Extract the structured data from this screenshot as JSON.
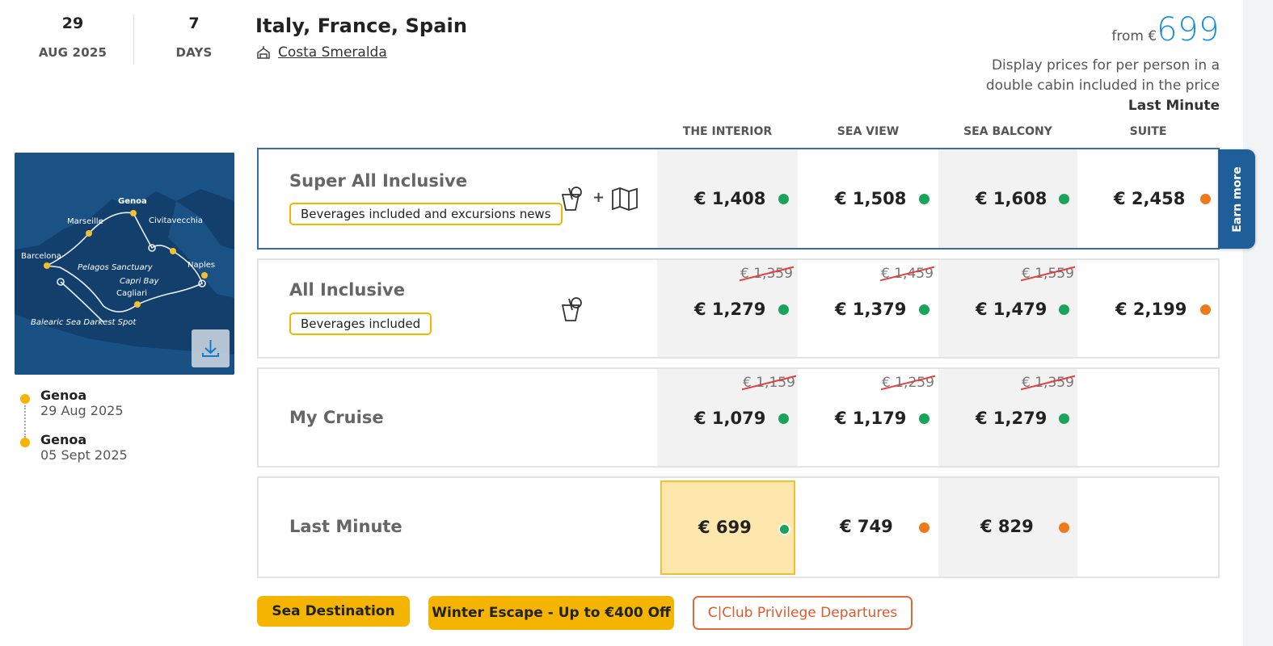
{
  "departure": {
    "day": "29",
    "month_year": "AUG 2025"
  },
  "duration": {
    "count": "7",
    "unit": "DAYS"
  },
  "title": "Italy, France, Spain",
  "ship": "Costa Smeralda",
  "from_price": {
    "prefix": "from €",
    "value": "699"
  },
  "price_note": {
    "line1": "Display prices for per person in a",
    "line2": "double cabin included in the price",
    "type": "Last Minute"
  },
  "columns": [
    "THE INTERIOR",
    "SEA VIEW",
    "SEA BALCONY",
    "SUITE"
  ],
  "map": {
    "labels": [
      "Genoa",
      "Marseille",
      "Civitavecchia",
      "Barcelona",
      "Pelagos Sanctuary",
      "Naples",
      "Capri Bay",
      "Cagliari",
      "Balearic Sea Darkest Spot"
    ]
  },
  "itinerary": [
    {
      "port": "Genoa",
      "date": "29 Aug 2025"
    },
    {
      "port": "Genoa",
      "date": "05 Sept 2025"
    }
  ],
  "rows": [
    {
      "name": "Super All Inclusive",
      "badge": "Beverages included and excursions news",
      "icons": [
        "beverages-icon",
        "excursion-map-icon"
      ],
      "plus": "+",
      "prices": [
        {
          "value": "€ 1,408",
          "status": "green"
        },
        {
          "value": "€ 1,508",
          "status": "green"
        },
        {
          "value": "€ 1,608",
          "status": "green"
        },
        {
          "value": "€ 2,458",
          "status": "orange"
        }
      ]
    },
    {
      "name": "All Inclusive",
      "badge": "Beverages included",
      "icons": [
        "beverages-icon"
      ],
      "prices": [
        {
          "old": "€ 1,359",
          "value": "€ 1,279",
          "status": "green"
        },
        {
          "old": "€ 1,459",
          "value": "€ 1,379",
          "status": "green"
        },
        {
          "old": "€ 1,559",
          "value": "€ 1,479",
          "status": "green"
        },
        {
          "value": "€ 2,199",
          "status": "orange"
        }
      ]
    },
    {
      "name": "My Cruise",
      "prices": [
        {
          "old": "€ 1,159",
          "value": "€ 1,079",
          "status": "green"
        },
        {
          "old": "€ 1,259",
          "value": "€ 1,179",
          "status": "green"
        },
        {
          "old": "€ 1,359",
          "value": "€ 1,279",
          "status": "green"
        }
      ]
    },
    {
      "name": "Last Minute",
      "prices": [
        {
          "value": "€ 699",
          "status": "green",
          "selected": true
        },
        {
          "value": "€ 749",
          "status": "orange"
        },
        {
          "value": "€ 829",
          "status": "orange"
        }
      ]
    }
  ],
  "earn_more": "Earn more",
  "tags": [
    "Sea Destination",
    "Winter Escape - Up to €400 Off",
    "C|Club Privilege Departures"
  ],
  "colors": {
    "accent_blue": "#1a90e0",
    "brand_yellow": "#f4b400",
    "status_green": "#1aa35a",
    "status_orange": "#ef7a1a",
    "selected_border": "#3a6da8"
  }
}
